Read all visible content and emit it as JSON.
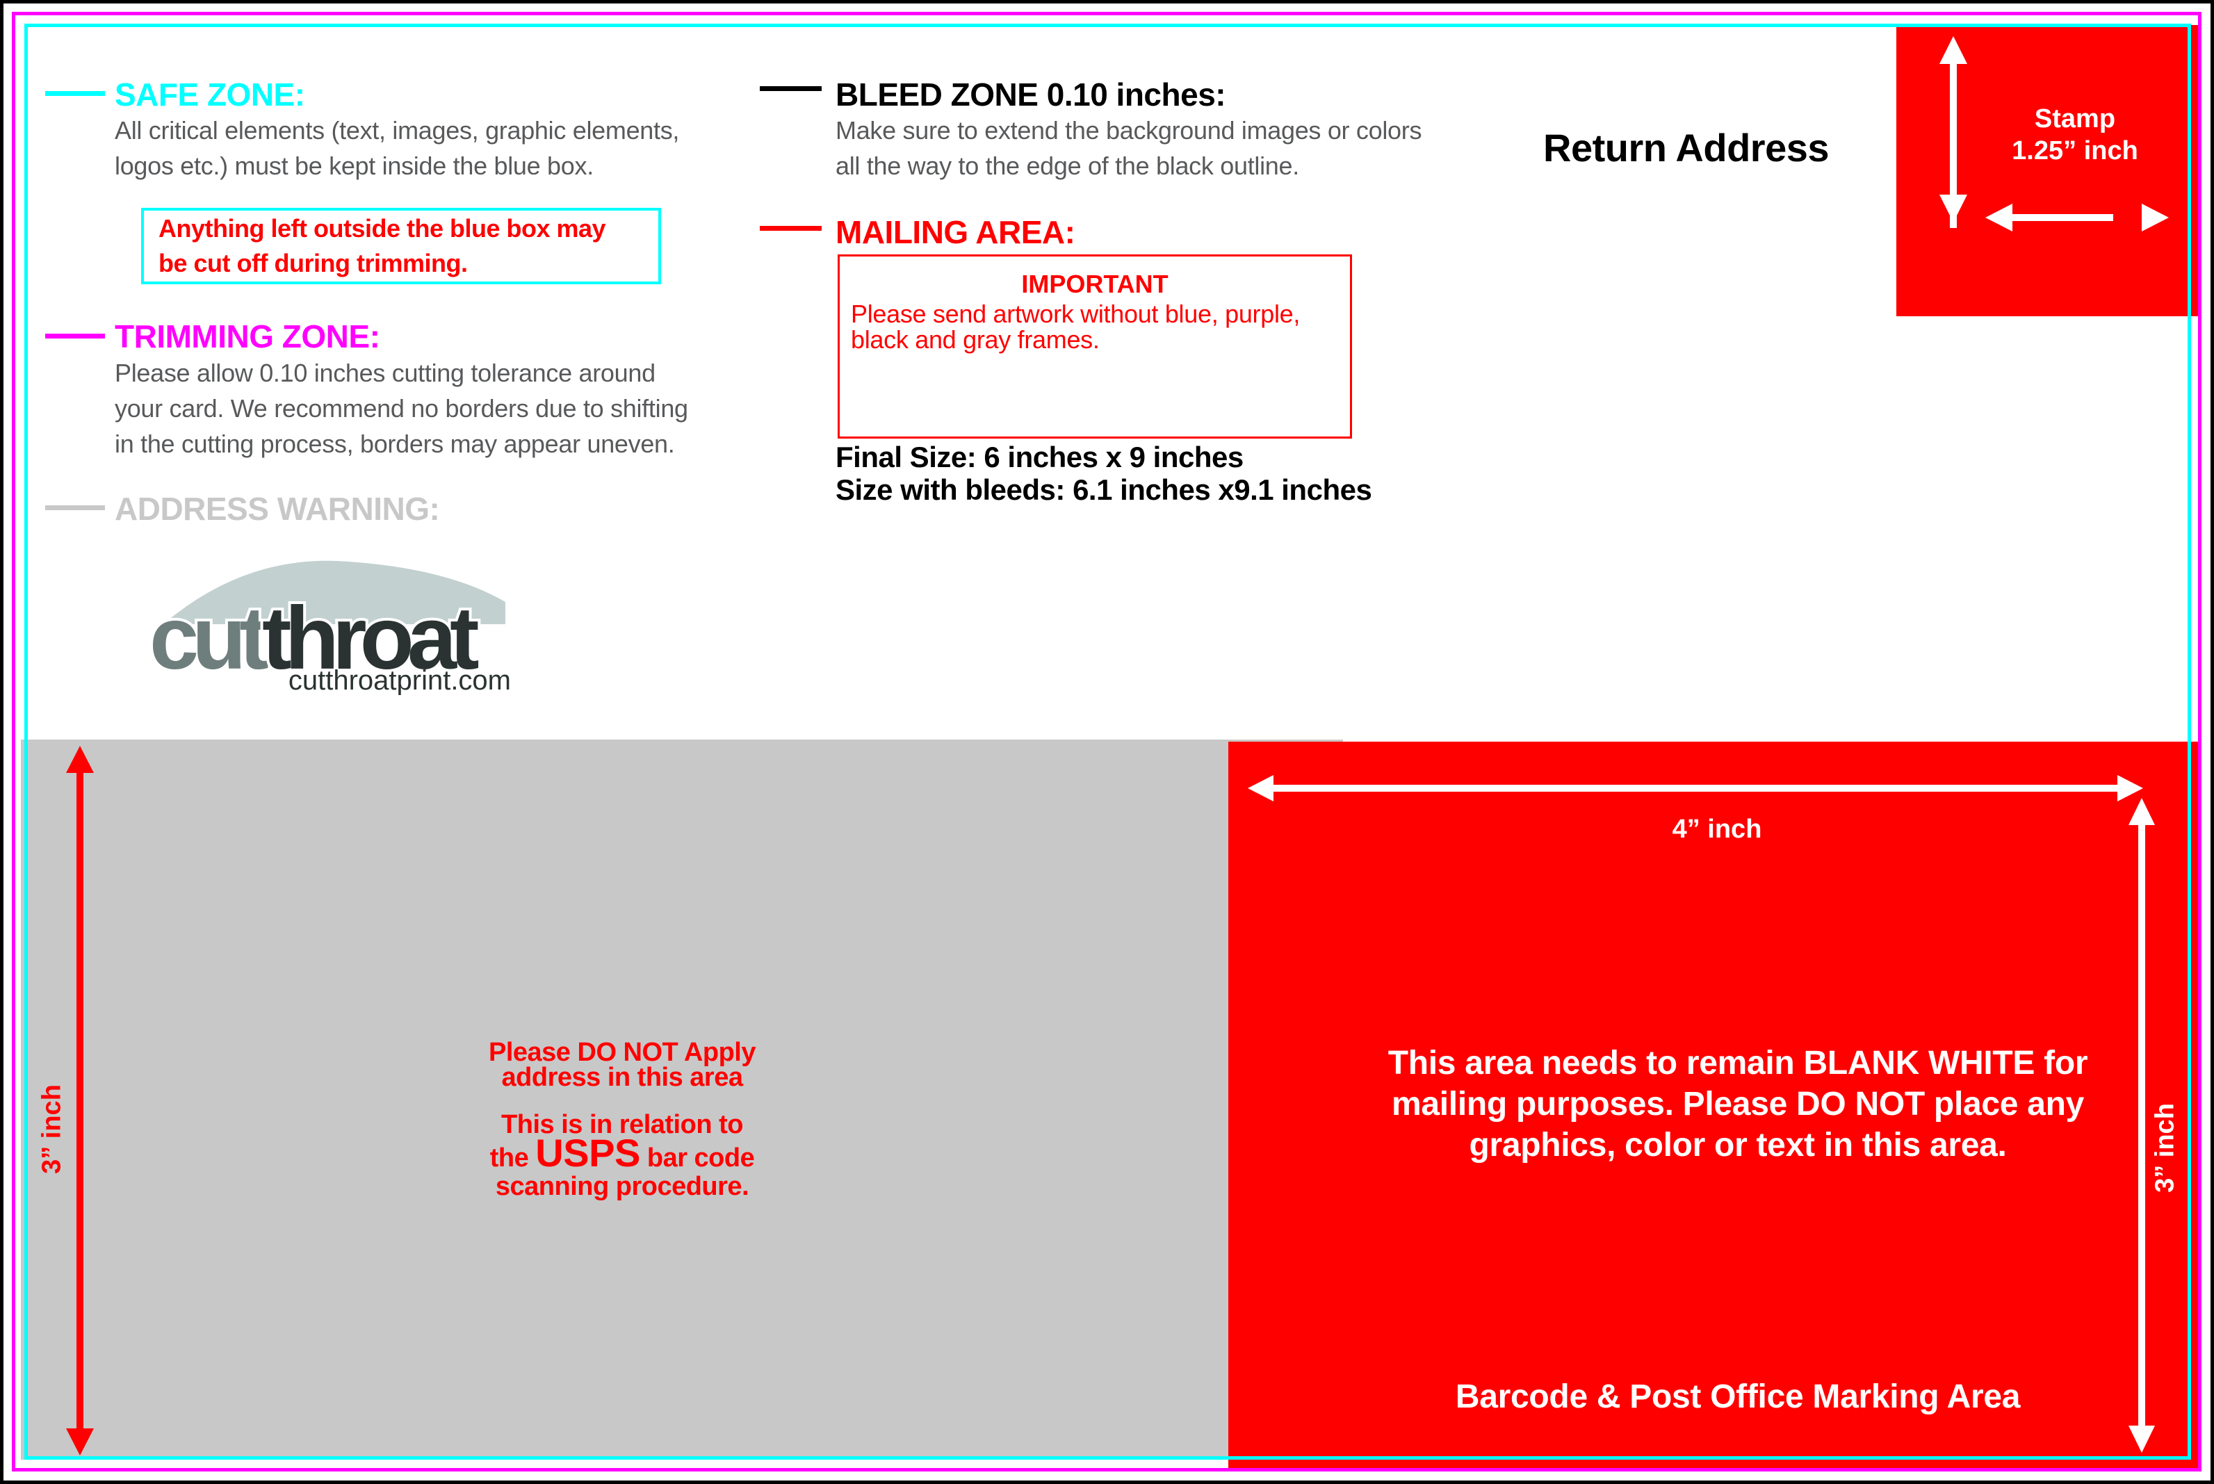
{
  "colors": {
    "safe_zone": "#00ffff",
    "trim_zone": "#ff00ff",
    "bleed_zone": "#000000",
    "mailing_area": "#ff0000",
    "address_warning": "#c8c8c8",
    "body_text": "#58595b"
  },
  "legend": {
    "safe_zone": {
      "icon": "cyan-line-swatch",
      "title": "SAFE ZONE:",
      "lines": [
        "All critical elements (text, images, graphic elements,",
        "logos etc.)  must be kept inside the blue box."
      ]
    },
    "safe_warning": {
      "lines": [
        "Anything left outside the blue box may",
        "be cut off during trimming."
      ]
    },
    "trimming_zone": {
      "icon": "magenta-line-swatch",
      "title": "TRIMMING ZONE:",
      "lines": [
        "Please allow 0.10 inches cutting tolerance around",
        "your card. We recommend no borders due to shifting",
        "in the cutting process, borders may appear uneven."
      ]
    },
    "address_warning": {
      "icon": "gray-line-swatch",
      "title": "ADDRESS WARNING:"
    },
    "bleed_zone": {
      "icon": "black-line-swatch",
      "title": "BLEED ZONE 0.10 inches:",
      "lines": [
        "Make sure to extend the background images or colors",
        "all the way to the edge of the black outline."
      ]
    },
    "mailing_area": {
      "icon": "red-line-swatch",
      "title": "MAILING AREA:"
    }
  },
  "important": {
    "title": "IMPORTANT",
    "lines": [
      "Please send artwork without blue, purple,",
      "black and gray frames."
    ]
  },
  "sizes": {
    "final_size": "Final Size: 6 inches x 9 inches",
    "bleed_size": "Size with bleeds: 6.1 inches x9.1 inches"
  },
  "logo": {
    "word_light": "cut",
    "word_dark": "throat",
    "url": "cutthroatprint.com"
  },
  "return_address": "Return Address",
  "stamp": {
    "label": "Stamp",
    "size": "1.25” inch"
  },
  "address_area": {
    "line1": "Please DO NOT Apply",
    "line2": "address in this area",
    "line3": "This is in relation to",
    "line4_pre": "the",
    "line4_em": "USPS",
    "line4_post": "bar code",
    "line5": "scanning procedure.",
    "height_label": "3” inch"
  },
  "barcode_area": {
    "width_label": "4” inch",
    "height_label": "3” inch",
    "note_lines": [
      "This area needs to remain BLANK WHITE for",
      "mailing purposes. Please DO NOT place any",
      "graphics, color or text in this area."
    ],
    "label": "Barcode & Post Office Marking Area"
  }
}
